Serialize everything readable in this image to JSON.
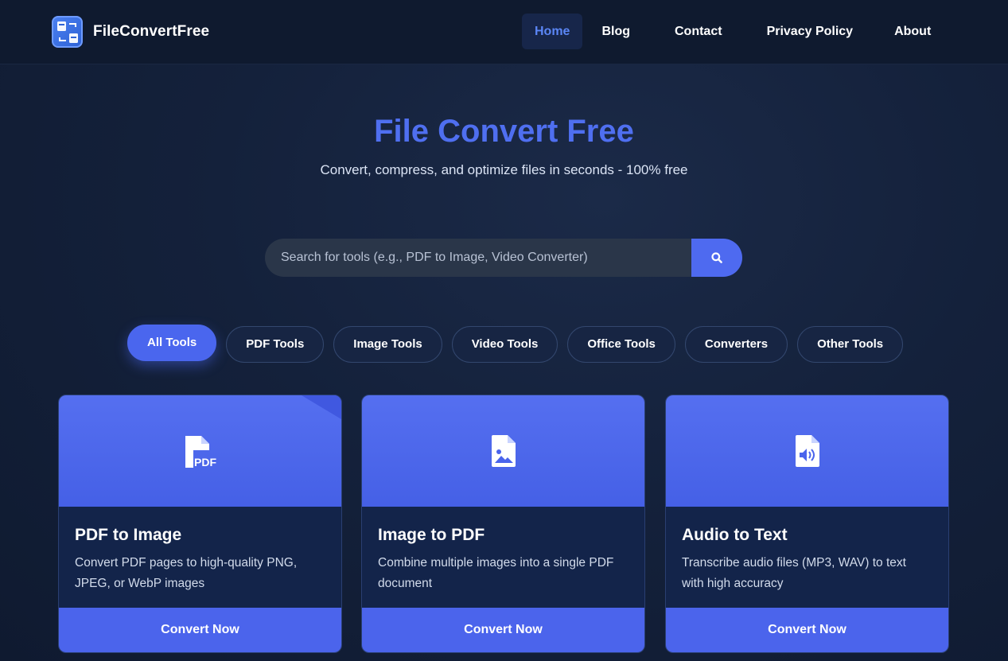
{
  "brand": {
    "name": "FileConvertFree",
    "logo_icon": "file-convert-logo-icon"
  },
  "nav": [
    {
      "label": "Home",
      "active": true
    },
    {
      "label": "Blog"
    },
    {
      "label": "Contact"
    },
    {
      "label": "Privacy Policy"
    },
    {
      "label": "About"
    }
  ],
  "hero": {
    "title": "File Convert Free",
    "subtitle": "Convert, compress, and optimize files in seconds - 100% free"
  },
  "search": {
    "placeholder": "Search for tools (e.g., PDF to Image, Video Converter)",
    "value": "",
    "button_icon": "search-icon"
  },
  "filters": [
    {
      "label": "All Tools",
      "active": true
    },
    {
      "label": "PDF Tools"
    },
    {
      "label": "Image Tools"
    },
    {
      "label": "Video Tools"
    },
    {
      "label": "Office Tools"
    },
    {
      "label": "Converters"
    },
    {
      "label": "Other Tools"
    }
  ],
  "cards": [
    {
      "title": "PDF to Image",
      "description": "Convert PDF pages to high-quality PNG, JPEG, or WebP images",
      "button": "Convert Now",
      "icon": "pdf-file-icon"
    },
    {
      "title": "Image to PDF",
      "description": "Combine multiple images into a single PDF document",
      "button": "Convert Now",
      "icon": "image-file-icon"
    },
    {
      "title": "Audio to Text",
      "description": "Transcribe audio files (MP3, WAV) to text with high accuracy",
      "button": "Convert Now",
      "icon": "audio-file-icon"
    }
  ],
  "colors": {
    "accent": "#4e6af0",
    "background": "#14213b",
    "header": "#0f1a2f"
  }
}
